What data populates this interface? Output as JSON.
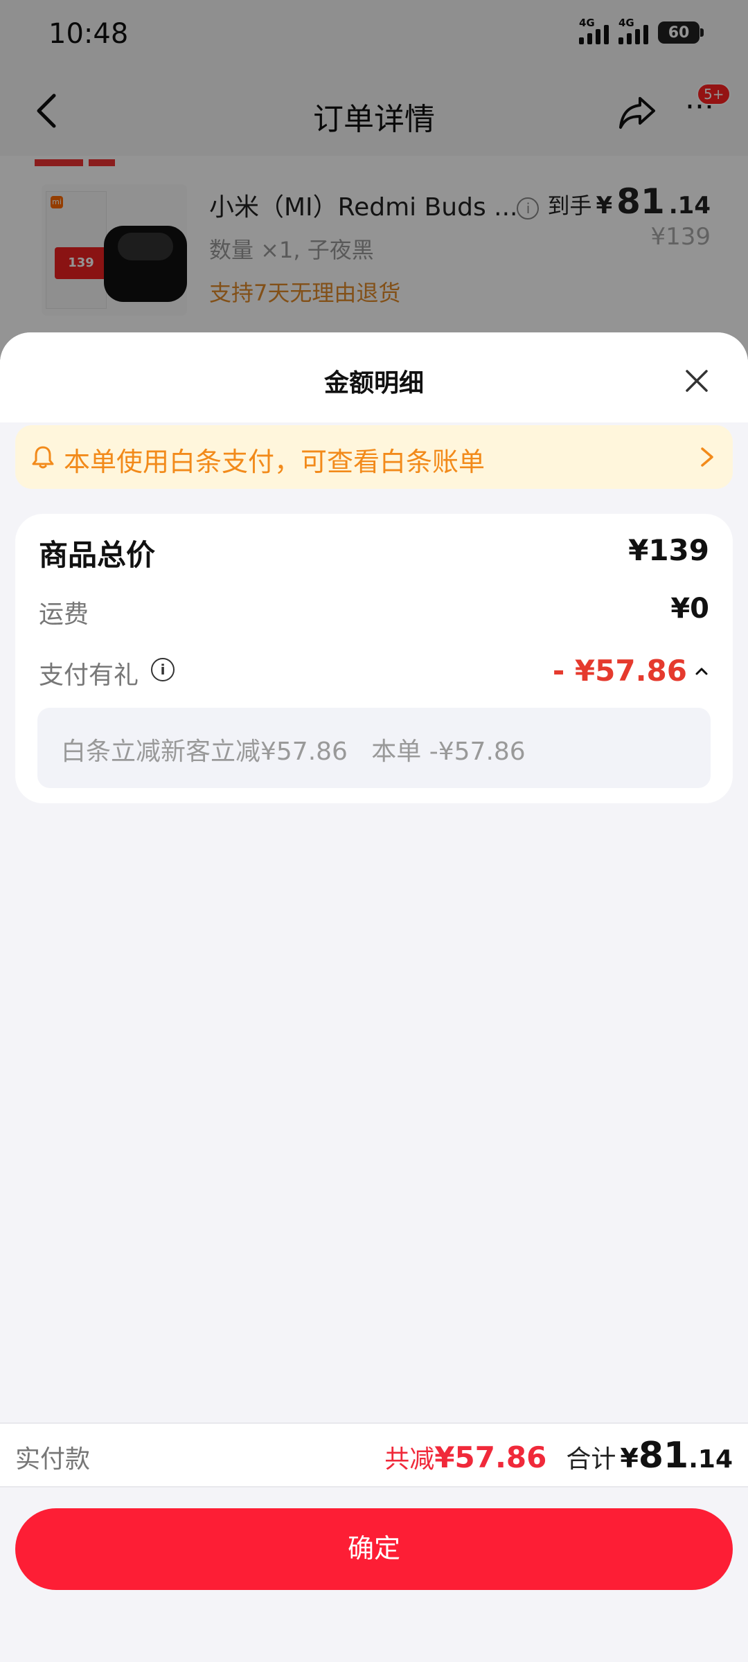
{
  "status_bar": {
    "time": "10:48",
    "signal1": "4G",
    "signal2": "4G",
    "battery": "60"
  },
  "nav": {
    "title": "订单详情",
    "more_badge": "5+"
  },
  "product": {
    "name": "小米（MI）Redmi Buds ...",
    "spec": "数量 ×1, 子夜黑",
    "return_policy": "支持7天无理由退货",
    "price_label": "到手",
    "price_yen": "¥",
    "price_int": "81",
    "price_dec": ".14",
    "original_price": "¥139",
    "thumb_badge": "139"
  },
  "sheet": {
    "title": "金额明细",
    "notice": "本单使用白条支付，可查看白条账单",
    "total_label": "商品总价",
    "total_value": "¥139",
    "shipping_label": "运费",
    "shipping_value": "¥0",
    "gift_label": "支付有礼",
    "gift_value": "- ¥57.86",
    "gift_detail": "白条立减新客立减¥57.86   本单 -¥57.86"
  },
  "bottom": {
    "pay_label": "实付款",
    "saved_label": "共减",
    "saved_value": "¥57.86",
    "sum_label": "合计",
    "sum_yen": "¥",
    "sum_int": "81",
    "sum_dec": ".14",
    "confirm": "确定"
  },
  "colors": {
    "accent": "#fd1e35",
    "discount": "#e53a2e",
    "notice_bg": "#fff6dc",
    "notice_text": "#f28a1a"
  },
  "icons": [
    "back-arrow-icon",
    "share-icon",
    "more-icon",
    "close-icon",
    "bell-icon",
    "chevron-right-icon",
    "info-icon",
    "chevron-up-icon"
  ]
}
